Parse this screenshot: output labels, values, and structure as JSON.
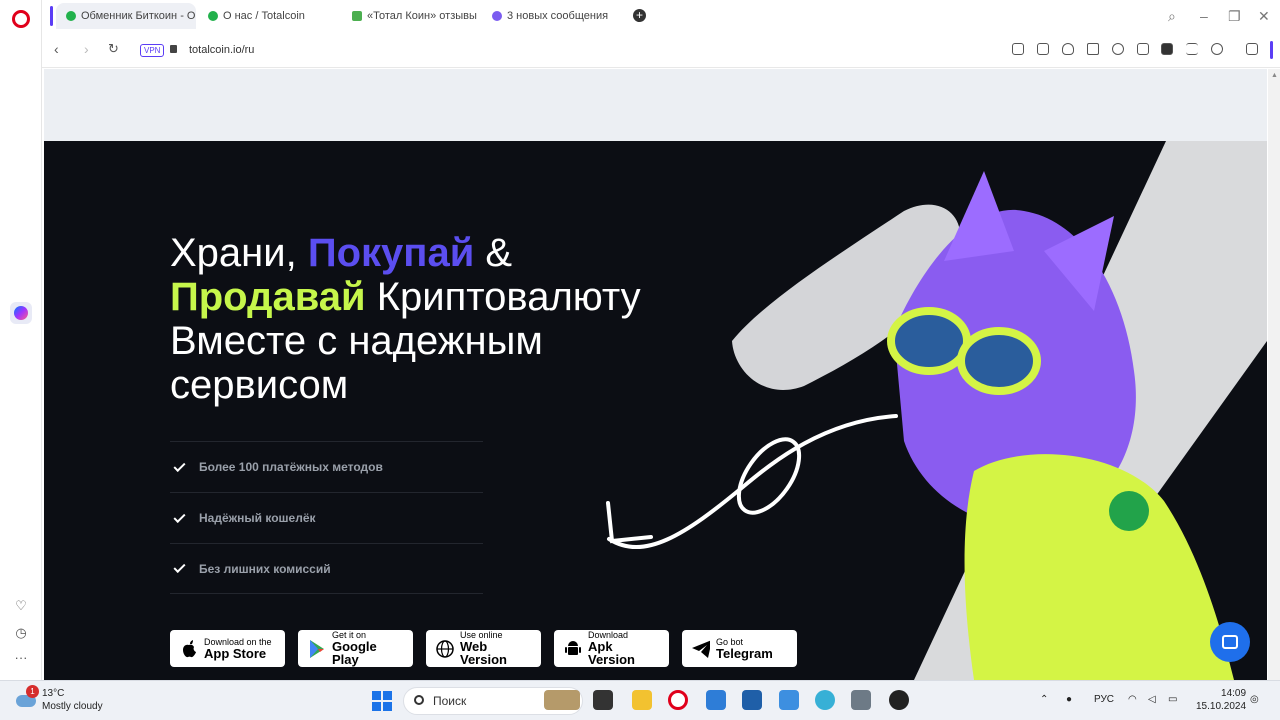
{
  "browser": {
    "tabs": [
      {
        "label": "Обменник Биткоин - Обм",
        "favicon_color": "#22b14c",
        "active": true
      },
      {
        "label": "О нас / Totalcoin",
        "favicon_color": "#22b14c",
        "active": false
      },
      {
        "label": "«Тотал Коин» отзывы о п",
        "favicon_color": "#4caf50",
        "active": false
      },
      {
        "label": "3 новых сообщения",
        "favicon_color": "#7b5cf0",
        "active": false
      }
    ],
    "new_tab_label": "+",
    "vpn_label": "VPN",
    "url": "totalcoin.io/ru"
  },
  "hero": {
    "heading": {
      "line1_a": "Храни, ",
      "line1_b": "Покупай",
      "line1_c": " &",
      "line2_a": "Продавай",
      "line2_b": " Криптовалюту",
      "line3": "Вместе с надежным",
      "line4": "сервисом"
    },
    "features": [
      "Более 100 платёжных методов",
      "Надёжный кошелёк",
      "Без лишних комиссий"
    ],
    "store_buttons": [
      {
        "small": "Download on the",
        "big": "App Store",
        "icon": "apple-icon"
      },
      {
        "small": "Get it on",
        "big": "Google Play",
        "icon": "google-play-icon"
      },
      {
        "small": "Use online",
        "big": "Web Version",
        "icon": "globe-icon"
      },
      {
        "small": "Download",
        "big": "Apk Version",
        "icon": "android-icon"
      },
      {
        "small": "Go bot",
        "big": "Telegram",
        "icon": "telegram-icon"
      }
    ]
  },
  "taskbar": {
    "notification_count": "1",
    "temperature": "13°C",
    "weather": "Mostly cloudy",
    "search_placeholder": "Поиск",
    "language": "РУС",
    "time": "14:09",
    "date": "15.10.2024"
  },
  "colors": {
    "accent_blue": "#5b4ef0",
    "accent_green": "#c6f64b",
    "hero_bg": "#0c0e14",
    "opera_red": "#e0001b"
  }
}
